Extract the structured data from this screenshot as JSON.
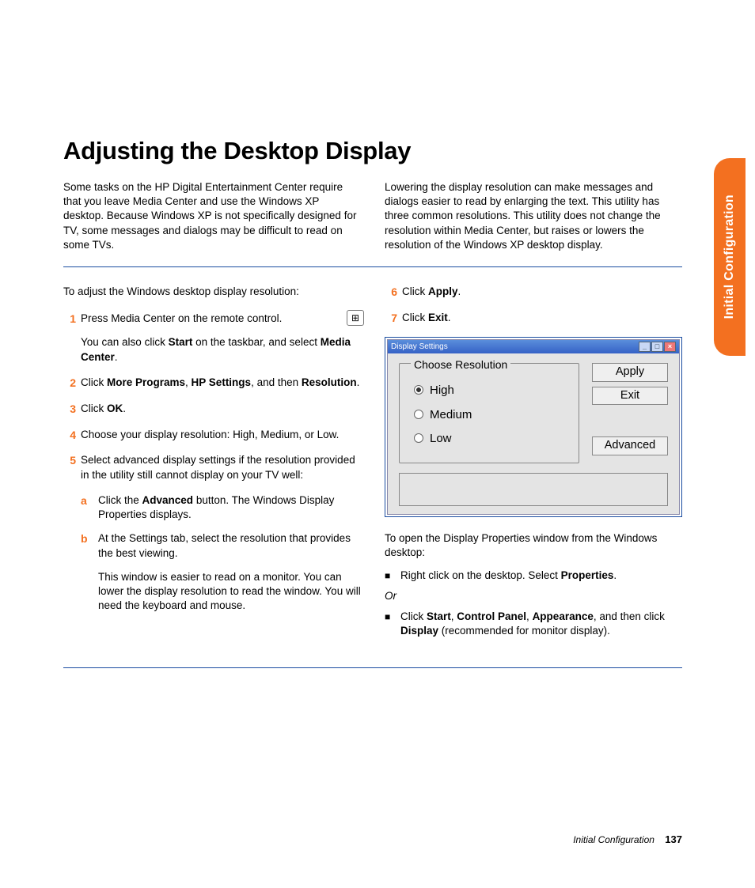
{
  "tab": "Initial Configuration",
  "title": "Adjusting the Desktop Display",
  "intro_left": "Some tasks on the HP Digital Entertainment Center require that you leave Media Center and use the Windows XP desktop. Because Windows XP is not specifically designed for TV, some messages and dialogs may be difficult to read on some TVs.",
  "intro_right": "Lowering the display resolution can make messages and dialogs easier to read by enlarging the text. This utility has three common resolutions. This utility does not change the resolution within Media Center, but raises or lowers the resolution of the Windows XP desktop display.",
  "lead": "To adjust the Windows desktop display resolution:",
  "steps": {
    "s1a": "Press Media Center on the remote control.",
    "s1b": "You can also click <b>Start</b> on the taskbar, and select <b>Media Center</b>.",
    "s2": "Click <b>More Programs</b>, <b>HP Settings</b>, and then <b>Resolution</b>.",
    "s3": "Click <b>OK</b>.",
    "s4": "Choose your display resolution: High, Medium, or Low.",
    "s5": "Select advanced display settings if the resolution provided in the utility still cannot display on your TV well:",
    "s5a": "Click the <b>Advanced</b> button. The Windows Display Properties displays.",
    "s5b1": "At the Settings tab, select the resolution that provides the best viewing.",
    "s5b2": "This window is easier to read on a monitor. You can lower the display resolution to read the window. You will need the keyboard and mouse.",
    "s6": "Click <b>Apply</b>.",
    "s7": "Click <b>Exit</b>."
  },
  "dialog": {
    "title": "Display Settings",
    "legend": "Choose Resolution",
    "opt_high": "High",
    "opt_medium": "Medium",
    "opt_low": "Low",
    "btn_apply": "Apply",
    "btn_exit": "Exit",
    "btn_advanced": "Advanced"
  },
  "lead2": "To open the Display Properties window from the Windows desktop:",
  "bul1": "Right click on the desktop. Select <b>Properties</b>.",
  "or": "Or",
  "bul2": "Click <b>Start</b>, <b>Control Panel</b>, <b>Appearance</b>, and then click <b>Display</b> (recommended for monitor display).",
  "footer_label": "Initial Configuration",
  "footer_page": "137",
  "winicon_glyph": "⊞"
}
